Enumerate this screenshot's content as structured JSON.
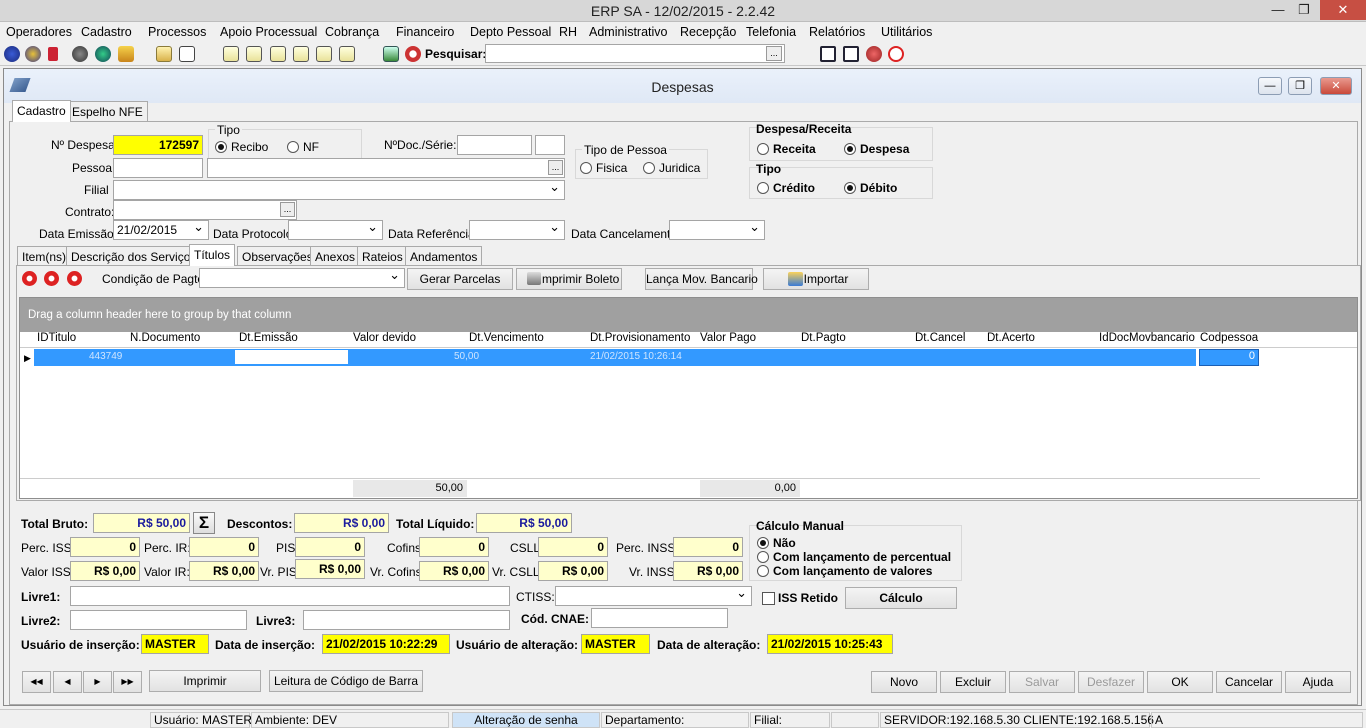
{
  "app": {
    "title": "ERP  SA - 12/02/2015 - 2.2.42",
    "minimize": "—",
    "maximize": "❐",
    "close": "✕"
  },
  "menu": [
    "Operadores",
    "Cadastro",
    "Processos",
    "Apoio Processual",
    "Cobrança",
    "Financeiro",
    "Depto Pessoal",
    "RH",
    "Administrativo",
    "Recepção",
    "Telefonia",
    "Relatórios",
    "Utilitários"
  ],
  "toolbar": {
    "search_label": "Pesquisar:",
    "search_value": "",
    "ellipsis": "..."
  },
  "window": {
    "title": "Despesas",
    "minimize": "—",
    "restore": "❐",
    "close": "✕"
  },
  "top_tabs": [
    "Cadastro",
    "Espelho NFE"
  ],
  "form": {
    "num_despesa_label": "Nº Despesa:",
    "num_despesa": "172597",
    "tipo_label": "Tipo",
    "recibo": "Recibo",
    "nf": "NF",
    "ndoc_label": "NºDoc./Série:",
    "tipo_pessoa_label": "Tipo de Pessoa",
    "fisica": "Fisica",
    "juridica": "Juridica",
    "despesa_receita_label": "Despesa/Receita",
    "receita": "Receita",
    "despesa": "Despesa",
    "tipo2_label": "Tipo",
    "credito": "Crédito",
    "debito": "Débito",
    "pessoa_label": "Pessoa:",
    "filial_label": "Filial :",
    "contrato_label": "Contrato:",
    "data_emissao_label": "Data Emissão :",
    "data_emissao": "21/02/2015",
    "data_protocolo_label": "Data Protocolo:",
    "data_referencia_label": "Data Referência:",
    "data_cancelamento_label": "Data Cancelamento:"
  },
  "sub_tabs": [
    "Item(ns)",
    "Descrição dos Serviços",
    "Títulos",
    "Observações",
    "Anexos",
    "Rateios",
    "Andamentos"
  ],
  "titulos": {
    "condicao_label": "Condição de Pagto:",
    "gerar_parcelas": "Gerar Parcelas",
    "imprimir_boleto": "Imprimir Boleto",
    "lanca_mov": "Lança Mov. Bancario",
    "importar": "Importar",
    "group_hint": "Drag a column header here to group by that column",
    "columns": [
      "IDTitulo",
      "N.Documento",
      "Dt.Emissão",
      "Valor devido",
      "Dt.Vencimento",
      "Dt.Provisionamento",
      "Valor Pago",
      "Dt.Pagto",
      "Dt.Cancel",
      "Dt.Acerto",
      "IdDocMovbancario",
      "Codpessoa"
    ],
    "row": {
      "id": "443749",
      "valor": "50,00",
      "dt_prov": "21/02/2015 10:26:14",
      "codpessoa": "0"
    },
    "footer_valor_devido": "50,00",
    "footer_valor_pago": "0,00"
  },
  "totals": {
    "total_bruto_label": "Total Bruto:",
    "total_bruto": "R$ 50,00",
    "sigma": "Σ",
    "descontos_label": "Descontos:",
    "descontos": "R$ 0,00",
    "total_liquido_label": "Total Líquido:",
    "total_liquido": "R$ 50,00",
    "perc_iss_label": "Perc. ISS:",
    "perc_iss": "0",
    "perc_ir_label": "Perc. IR:",
    "perc_ir": "0",
    "pis_label": "PIS",
    "pis": "0",
    "cofins_label": "Cofins",
    "cofins": "0",
    "csll_label": "CSLL",
    "csll": "0",
    "perc_inss_label": "Perc. INSS:",
    "perc_inss": "0",
    "valor_iss_label": "Valor ISS:",
    "valor_iss": "R$ 0,00",
    "valor_ir_label": "Valor IR:",
    "valor_ir": "R$ 0,00",
    "vr_pis_label": "Vr. PIS",
    "vr_pis": "R$ 0,00",
    "vr_cofins_label": "Vr. Cofins",
    "vr_cofins": "R$ 0,00",
    "vr_csll_label": "Vr. CSLL",
    "vr_csll": "R$ 0,00",
    "vr_inss_label": "Vr. INSS",
    "vr_inss": "R$ 0,00"
  },
  "calculo": {
    "title": "Cálculo Manual",
    "nao": "Não",
    "com_perc": "Com lançamento de percentual",
    "com_val": "Com lançamento de valores",
    "iss_retido": "ISS Retido",
    "calculo_btn": "Cálculo"
  },
  "extra": {
    "livre1_label": "Livre1:",
    "ctiss_label": "CTISS:",
    "livre2_label": "Livre2:",
    "livre3_label": "Livre3:",
    "cnae_label": "Cód. CNAE:"
  },
  "audit": {
    "usuario_ins_label": "Usuário de inserção:",
    "usuario_ins": "MASTER",
    "data_ins_label": "Data de inserção:",
    "data_ins": "21/02/2015 10:22:29",
    "usuario_alt_label": "Usuário de alteração:",
    "usuario_alt": "MASTER",
    "data_alt_label": "Data de alteração:",
    "data_alt": "21/02/2015 10:25:43"
  },
  "nav": {
    "first": "◀◀",
    "prev": "◀",
    "next": "▶",
    "last": "▶▶"
  },
  "buttons": {
    "imprimir": "Imprimir",
    "leitura": "Leitura de Código de Barra",
    "novo": "Novo",
    "excluir": "Excluir",
    "salvar": "Salvar",
    "desfazer": "Desfazer",
    "ok": "OK",
    "cancelar": "Cancelar",
    "ajuda": "Ajuda"
  },
  "statusbar": {
    "usuario": "Usuário: MASTER",
    "ambiente": "Ambiente: DEV",
    "alteracao_senha": "Alteração de senha",
    "departamento": "Departamento:",
    "filial": "Filial:",
    "servidor": "SERVIDOR:192.168.5.30 CLIENTE:192.168.5.156",
    "a": "A"
  },
  "colors": {
    "yellow_field": "#ffffcc",
    "highlight": "#ffff00",
    "selection": "#3399ff",
    "blue_text": "#1b1b9e"
  }
}
